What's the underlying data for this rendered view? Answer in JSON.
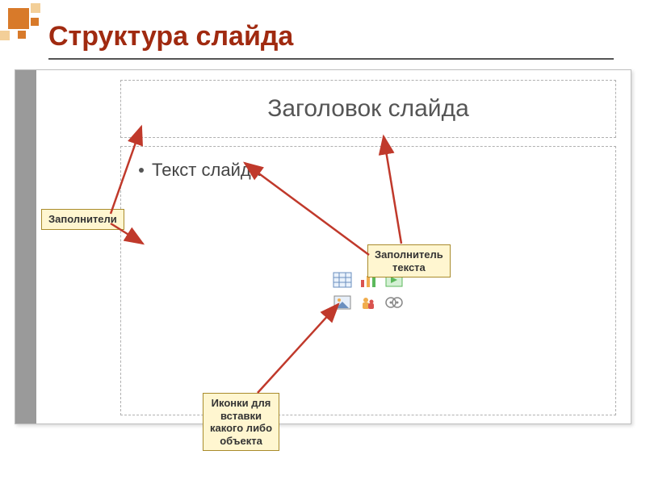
{
  "page_title": "Структура слайда",
  "slide": {
    "title_text": "Заголовок слайда",
    "body_bullet_text": "Текст слайда"
  },
  "callouts": {
    "placeholders": "Заполнители",
    "text_placeholder": "Заполнитель\nтекста",
    "icons": "Иконки для\nвставки\nкакого либо\nобъекта"
  },
  "icons": [
    "table-icon",
    "chart-icon",
    "slide-icon",
    "image-icon",
    "people-icon",
    "media-icon"
  ]
}
